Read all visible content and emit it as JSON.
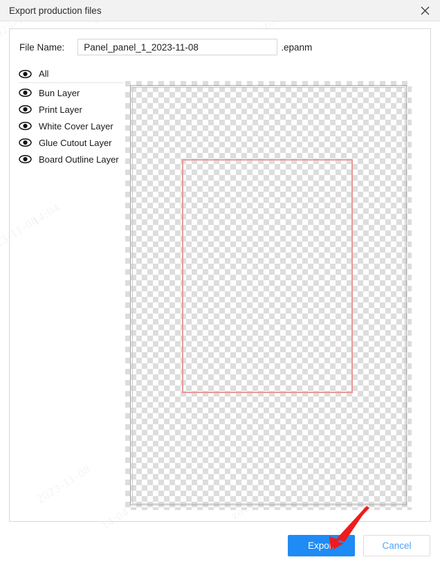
{
  "window": {
    "title": "Export production files",
    "close_icon": "close-icon"
  },
  "form": {
    "filename_label": "File Name:",
    "filename_value": "Panel_panel_1_2023-11-08",
    "filename_placeholder": "",
    "extension_label": ".epanm"
  },
  "layers": {
    "items": [
      {
        "label": "All",
        "icon": "eye-icon"
      },
      {
        "label": "Bun Layer",
        "icon": "eye-icon"
      },
      {
        "label": "Print Layer",
        "icon": "eye-icon"
      },
      {
        "label": "White Cover Layer",
        "icon": "eye-icon"
      },
      {
        "label": "Glue Cutout Layer",
        "icon": "eye-icon"
      },
      {
        "label": "Board Outline Layer",
        "icon": "eye-icon"
      }
    ]
  },
  "preview": {
    "name": "transparency-checkerboard-canvas",
    "board_outline_color": "#e79a9a",
    "frame_color": "#a8a8a8"
  },
  "footer": {
    "export_label": "Export",
    "cancel_label": "Cancel",
    "export_color": "#1f8bf5",
    "cancel_text_color": "#4da3f7"
  },
  "annotation": {
    "arrow_color": "#ee1c1c"
  },
  "watermarks": [
    "2023-11-08",
    "14:04",
    "zouyuqing",
    "2023-11-08",
    "14:04",
    "zouyuqing",
    "2023-11-08",
    "14:04",
    "zouyuqing",
    "2023-11-08",
    "14:04",
    "zouyuqing"
  ]
}
